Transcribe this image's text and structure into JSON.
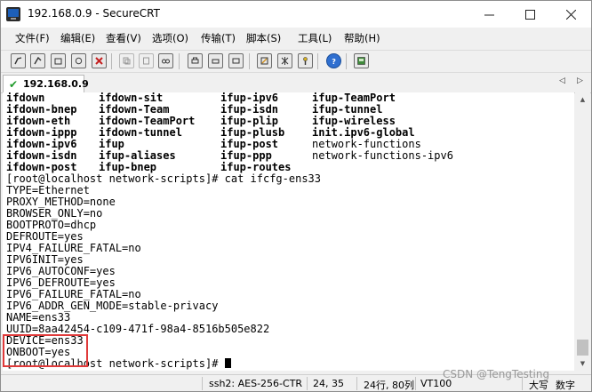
{
  "window": {
    "title": "192.168.0.9 - SecureCRT"
  },
  "menu": [
    "文件(F)",
    "编辑(E)",
    "查看(V)",
    "选项(O)",
    "传输(T)",
    "脚本(S)",
    "工具(L)",
    "帮助(H)"
  ],
  "toolbar_icons": [
    "connect-icon",
    "quick-connect-icon",
    "connect-tab-icon",
    "reconnect-icon",
    "disconnect-icon",
    "copy-icon",
    "paste-icon",
    "find-icon",
    "search-icon",
    "print-icon",
    "print-setup-icon",
    "print-icon-2",
    "session-options-icon",
    "global-options-icon",
    "keymap-icon",
    "help-icon",
    "sftp-icon"
  ],
  "tab": {
    "label": "192.168.0.9"
  },
  "terminal": {
    "columns": [
      [
        "ifdown",
        "ifdown-sit",
        "ifup-ipv6",
        "ifup-TeamPort"
      ],
      [
        "ifdown-bnep",
        "ifdown-Team",
        "ifup-isdn",
        "ifup-tunnel"
      ],
      [
        "ifdown-eth",
        "ifdown-TeamPort",
        "ifup-plip",
        "ifup-wireless"
      ],
      [
        "ifdown-ippp",
        "ifdown-tunnel",
        "ifup-plusb",
        "init.ipv6-global"
      ],
      [
        "ifdown-ipv6",
        "ifup",
        "ifup-post",
        "network-functions"
      ],
      [
        "ifdown-isdn",
        "ifup-aliases",
        "ifup-ppp",
        "network-functions-ipv6"
      ],
      [
        "ifdown-post",
        "ifup-bnep",
        "ifup-routes",
        ""
      ]
    ],
    "lines": [
      "[root@localhost network-scripts]# cat ifcfg-ens33",
      "TYPE=Ethernet",
      "PROXY_METHOD=none",
      "BROWSER_ONLY=no",
      "BOOTPROTO=dhcp",
      "DEFROUTE=yes",
      "IPV4_FAILURE_FATAL=no",
      "IPV6INIT=yes",
      "IPV6_AUTOCONF=yes",
      "IPV6_DEFROUTE=yes",
      "IPV6_FAILURE_FATAL=no",
      "IPV6_ADDR_GEN_MODE=stable-privacy",
      "NAME=ens33",
      "UUID=8aa42454-c109-471f-98a4-8516b505e822",
      "DEVICE=ens33",
      "ONBOOT=yes"
    ],
    "prompt": "[root@localhost network-scripts]# "
  },
  "status": {
    "cipher": "ssh2: AES-256-CTR",
    "position": "24,  35",
    "size": "24行, 80列",
    "term": "VT100",
    "caps": "大写",
    "num": "数字"
  },
  "watermark": "CSDN @TengTesting"
}
